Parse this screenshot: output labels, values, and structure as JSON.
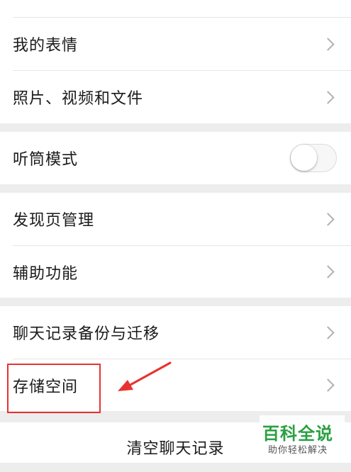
{
  "settings": {
    "group1": [
      {
        "label": "我的表情"
      },
      {
        "label": "照片、视频和文件"
      }
    ],
    "group2": [
      {
        "label": "听筒模式"
      }
    ],
    "group3": [
      {
        "label": "发现页管理"
      },
      {
        "label": "辅助功能"
      }
    ],
    "group4": [
      {
        "label": "聊天记录备份与迁移"
      },
      {
        "label": "存储空间"
      }
    ],
    "clear_chat_label": "清空聊天记录"
  },
  "annotation": {
    "box_color": "#e8322f",
    "arrow_color": "#e8322f"
  },
  "watermark": {
    "title": "百科全说",
    "subtitle": "助你轻松解决",
    "color": "#2aa042"
  }
}
